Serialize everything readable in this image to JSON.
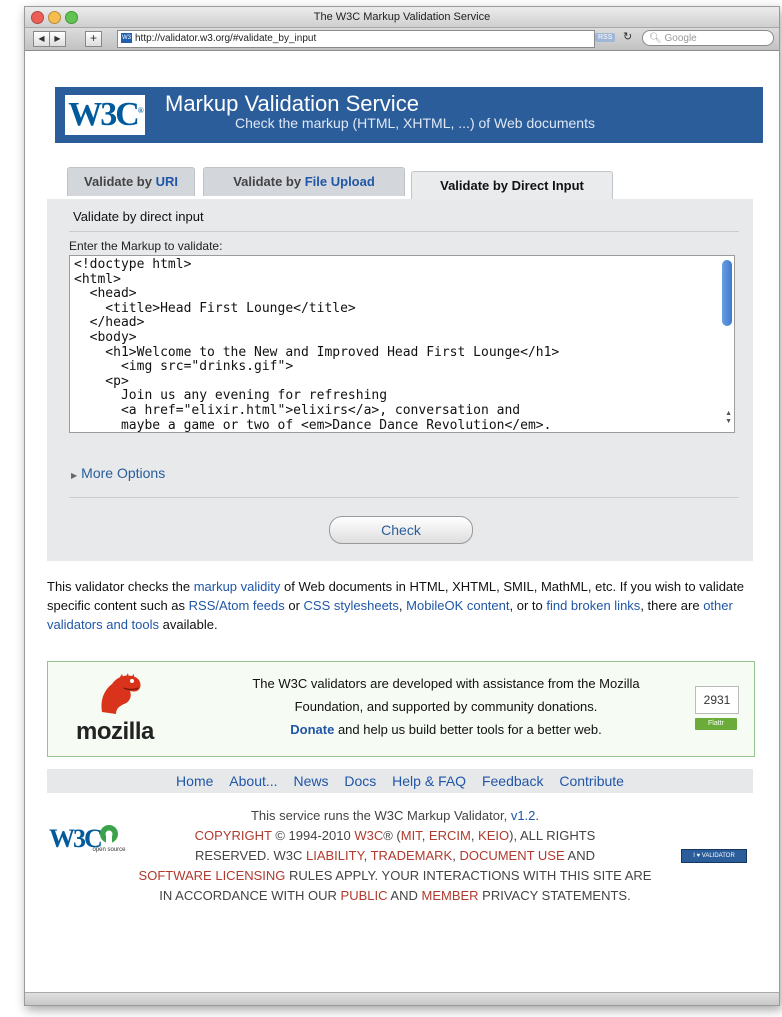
{
  "window": {
    "title": "The W3C Markup Validation Service",
    "url": "http://validator.w3.org/#validate_by_input",
    "search_placeholder": "Google",
    "rss_label": "RSS"
  },
  "header": {
    "logo": "W3C",
    "logo_mark": "®",
    "title": "Markup Validation Service",
    "subtitle": "Check the markup (HTML, XHTML, ...) of Web documents"
  },
  "tabs": [
    {
      "prefix": "Validate by ",
      "link": "URI"
    },
    {
      "prefix": "Validate by ",
      "link": "File Upload"
    },
    {
      "prefix": "Validate by ",
      "link": "Direct Input"
    }
  ],
  "form": {
    "heading": "Validate by direct input",
    "field_label": "Enter the Markup to validate:",
    "markup": "<!doctype html>\n<html>\n  <head>\n    <title>Head First Lounge</title>\n  </head>\n  <body>\n    <h1>Welcome to the New and Improved Head First Lounge</h1>\n      <img src=\"drinks.gif\">\n    <p>\n      Join us any evening for refreshing\n      <a href=\"elixir.html\">elixirs</a>, conversation and\n      maybe a game or two of <em>Dance Dance Revolution</em>.",
    "more_options": "More Options",
    "check_button": "Check"
  },
  "intro": {
    "t1": "This validator checks the ",
    "l1": "markup validity",
    "t2": " of Web documents in HTML, XHTML, SMIL, MathML, etc. If you wish to validate specific content such as ",
    "l2": "RSS/Atom feeds",
    "t3": " or ",
    "l3": "CSS stylesheets",
    "t4": ", ",
    "l4": "MobileOK content",
    "t5": ", or to ",
    "l5": "find broken links",
    "t6": ", there are ",
    "l6": "other validators and tools",
    "t7": " available."
  },
  "mozilla": {
    "wordmark": "mozilla",
    "line1": "The W3C validators are developed with assistance from the Mozilla",
    "line2": "Foundation, and supported by community donations.",
    "donate": "Donate",
    "line3": " and help us build better tools for a better web.",
    "count": "2931",
    "flattr": "Flattr"
  },
  "nav": [
    "Home",
    "About...",
    "News",
    "Docs",
    "Help & FAQ",
    "Feedback",
    "Contribute"
  ],
  "footer": {
    "l1_text": "This service runs the W3C Markup Validator, ",
    "l1_version": "v1.2",
    "l1_end": ".",
    "copyright": "COPYRIGHT",
    "years": " © 1994-2010 ",
    "w3c": "W3C",
    "reg": "® (",
    "mit": "MIT",
    "comma1": ", ",
    "ercim": "ERCIM",
    "comma2": ", ",
    "keio": "KEIO",
    "all_rights": "), ALL RIGHTS",
    "reserved": "RESERVED. W3C ",
    "liability": "LIABILITY",
    "c3": ", ",
    "trademark": "TRADEMARK",
    "c4": ", ",
    "docuse": "DOCUMENT USE",
    "and": " AND",
    "software": "SOFTWARE LICENSING",
    "rules": " RULES APPLY. YOUR INTERACTIONS WITH THIS SITE ARE",
    "in_acc": "IN ACCORDANCE WITH OUR ",
    "public": "PUBLIC",
    "and2": " AND ",
    "member": "MEMBER",
    "privacy": " PRIVACY STATEMENTS."
  },
  "badges": {
    "w3c": "W3C",
    "opensource": "open source",
    "validator": "I ♥ VALIDATOR"
  }
}
